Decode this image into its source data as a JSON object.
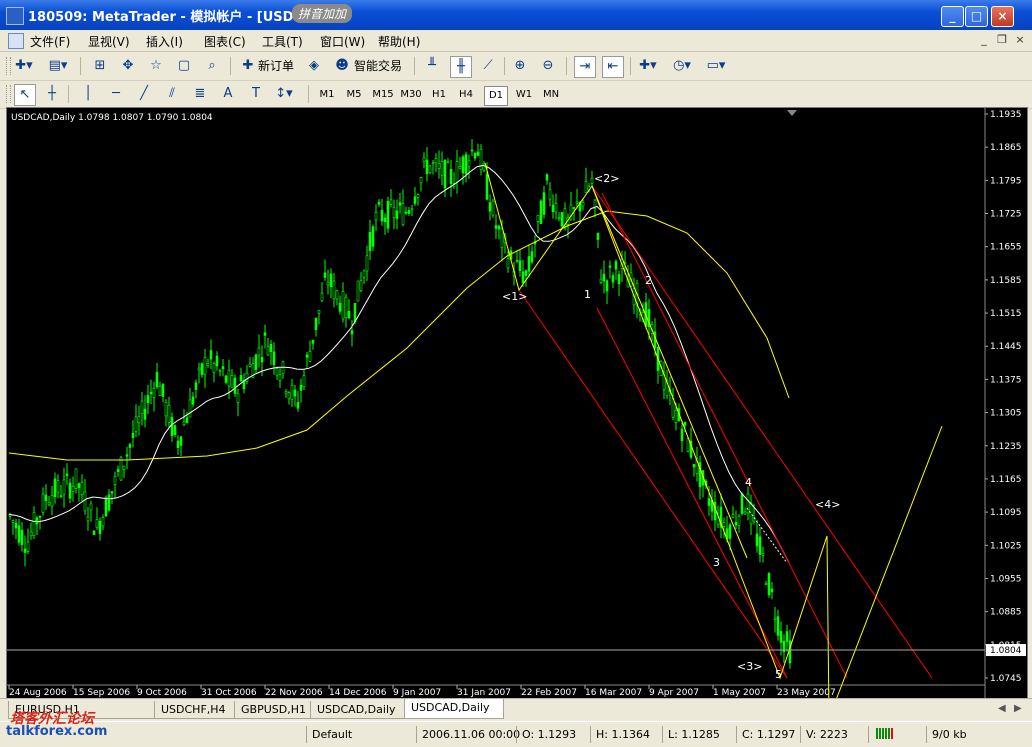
{
  "window": {
    "title": "180509: MetaTrader - 模拟帐户 - [USDCA",
    "overlay_text": "拼音加加",
    "minimize": "_",
    "maximize": "□",
    "close": "×"
  },
  "menu": {
    "items": [
      "文件(F)",
      "显视(V)",
      "插入(I)",
      "图表(C)",
      "工具(T)",
      "窗口(W)",
      "帮助(H)"
    ],
    "mdi_minimize": "_",
    "mdi_restore": "❐",
    "mdi_close": "×"
  },
  "toolbar": {
    "new_order": "新订单",
    "expert_trading": "智能交易"
  },
  "timeframes": [
    "M1",
    "M5",
    "M15",
    "M30",
    "H1",
    "H4",
    "D1",
    "W1",
    "MN"
  ],
  "active_timeframe": "D1",
  "chart": {
    "header": "USDCAD,Daily  1.0798 1.0807 1.0790 1.0804",
    "current_price": "1.0804",
    "price_labels": [
      "1.1935",
      "1.1865",
      "1.1795",
      "1.1725",
      "1.1655",
      "1.1585",
      "1.1515",
      "1.1445",
      "1.1375",
      "1.1305",
      "1.1235",
      "1.1165",
      "1.1095",
      "1.1025",
      "1.0955",
      "1.0885",
      "1.0815",
      "1.0745"
    ],
    "date_labels": [
      "24 Aug 2006",
      "15 Sep 2006",
      "9 Oct 2006",
      "31 Oct 2006",
      "22 Nov 2006",
      "14 Dec 2006",
      "9 Jan 2007",
      "31 Jan 2007",
      "22 Feb 2007",
      "16 Mar 2007",
      "9 Apr 2007",
      "1 May 2007",
      "23 May 2007"
    ],
    "wave_labels": [
      "<1>",
      "<2>",
      "1",
      "2",
      "3",
      "4",
      "<3>",
      "5",
      "<4>"
    ],
    "colors": {
      "background": "#000000",
      "candles": "#00FF00",
      "ma_fast": "#FFFFFF",
      "ma_slow": "#FFFF00",
      "channel": "#FF0000",
      "waves": "#FFFF00",
      "axis_text": "#FFFFFF"
    }
  },
  "tabs": [
    "EURUSD,H1",
    "USDCHF,H4",
    "GBPUSD,H1",
    "USDCAD,Daily",
    "USDCAD,Daily"
  ],
  "active_tab": 4,
  "status": {
    "profile": "Default",
    "time": "2006.11.06 00:00",
    "open": "O: 1.1293",
    "high": "H: 1.1364",
    "low": "L: 1.1285",
    "close": "C: 1.1297",
    "volume": "V: 2223",
    "traffic": "9/0 kb"
  },
  "watermark": {
    "cn": "塔客外汇论坛",
    "url": "talkforex.com"
  }
}
